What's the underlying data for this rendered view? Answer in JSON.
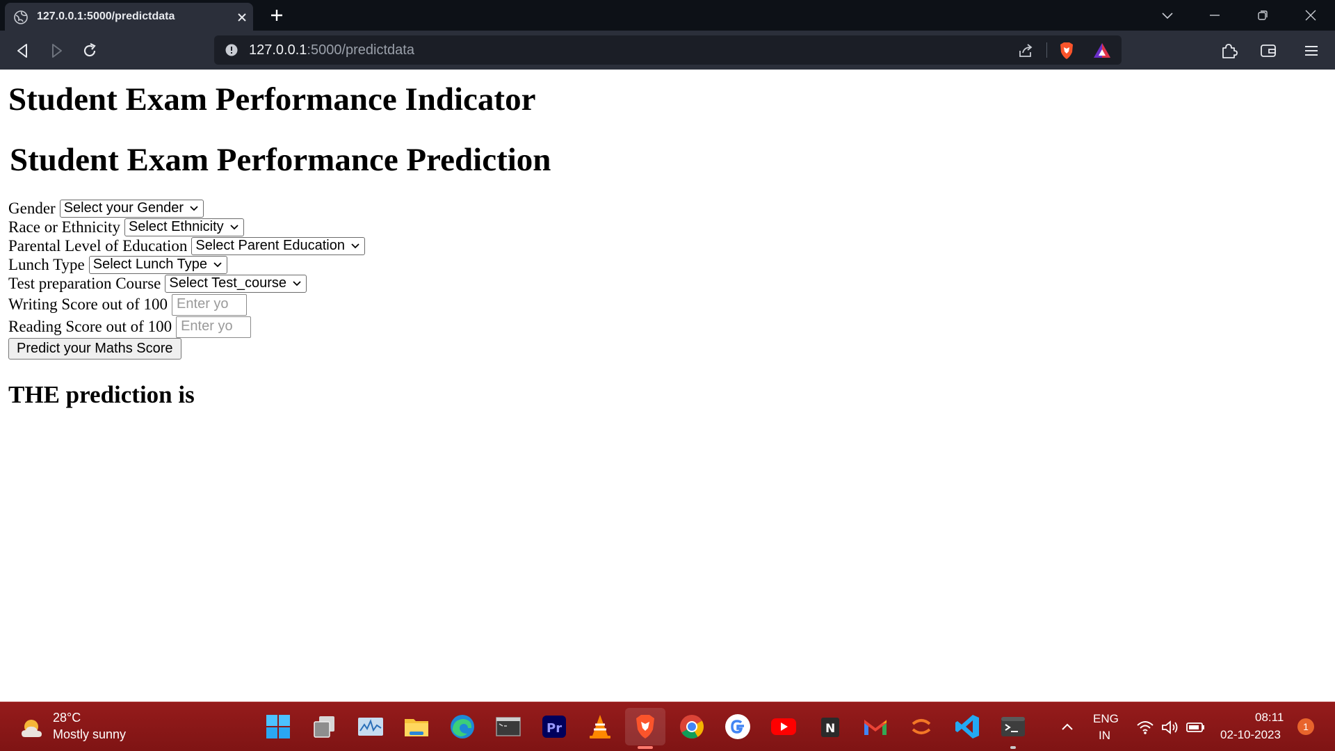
{
  "browser": {
    "tab_title": "127.0.0.1:5000/predictdata",
    "url_host": "127.0.0.1",
    "url_path": ":5000/predictdata"
  },
  "page": {
    "title": "Student Exam Performance Indicator",
    "form_title": "Student Exam Performance Prediction",
    "fields": {
      "gender": {
        "label": "Gender",
        "value": "Select your Gender"
      },
      "ethnicity": {
        "label": "Race or Ethnicity",
        "value": "Select Ethnicity"
      },
      "parent_education": {
        "label": "Parental Level of Education",
        "value": "Select Parent Education"
      },
      "lunch": {
        "label": "Lunch Type",
        "value": "Select Lunch Type"
      },
      "test_course": {
        "label": "Test preparation Course",
        "value": "Select Test_course"
      },
      "writing_score": {
        "label": "Writing Score out of 100",
        "placeholder": "Enter yo"
      },
      "reading_score": {
        "label": "Reading Score out of 100",
        "placeholder": "Enter yo"
      }
    },
    "submit_label": "Predict your Maths Score",
    "result_label": "THE prediction is"
  },
  "taskbar": {
    "weather_temp": "28°C",
    "weather_desc": "Mostly sunny",
    "apps": [
      "start-icon",
      "task-view-icon",
      "resource-monitor-icon",
      "file-explorer-icon",
      "edge-icon",
      "terminal-window-icon",
      "premiere-pro-icon",
      "vlc-icon",
      "brave-icon",
      "chrome-icon",
      "google-icon",
      "youtube-icon",
      "notion-icon",
      "gmail-icon",
      "jupyter-icon",
      "vscode-icon",
      "windows-terminal-icon"
    ],
    "language": "ENG",
    "region": "IN",
    "time": "08:11",
    "date": "02-10-2023",
    "notification_count": "1"
  },
  "colors": {
    "chrome_dark": "#0d1117",
    "toolbar": "#2b2f3a",
    "taskbar": "#8b1717",
    "brave_orange": "#fb542b"
  }
}
